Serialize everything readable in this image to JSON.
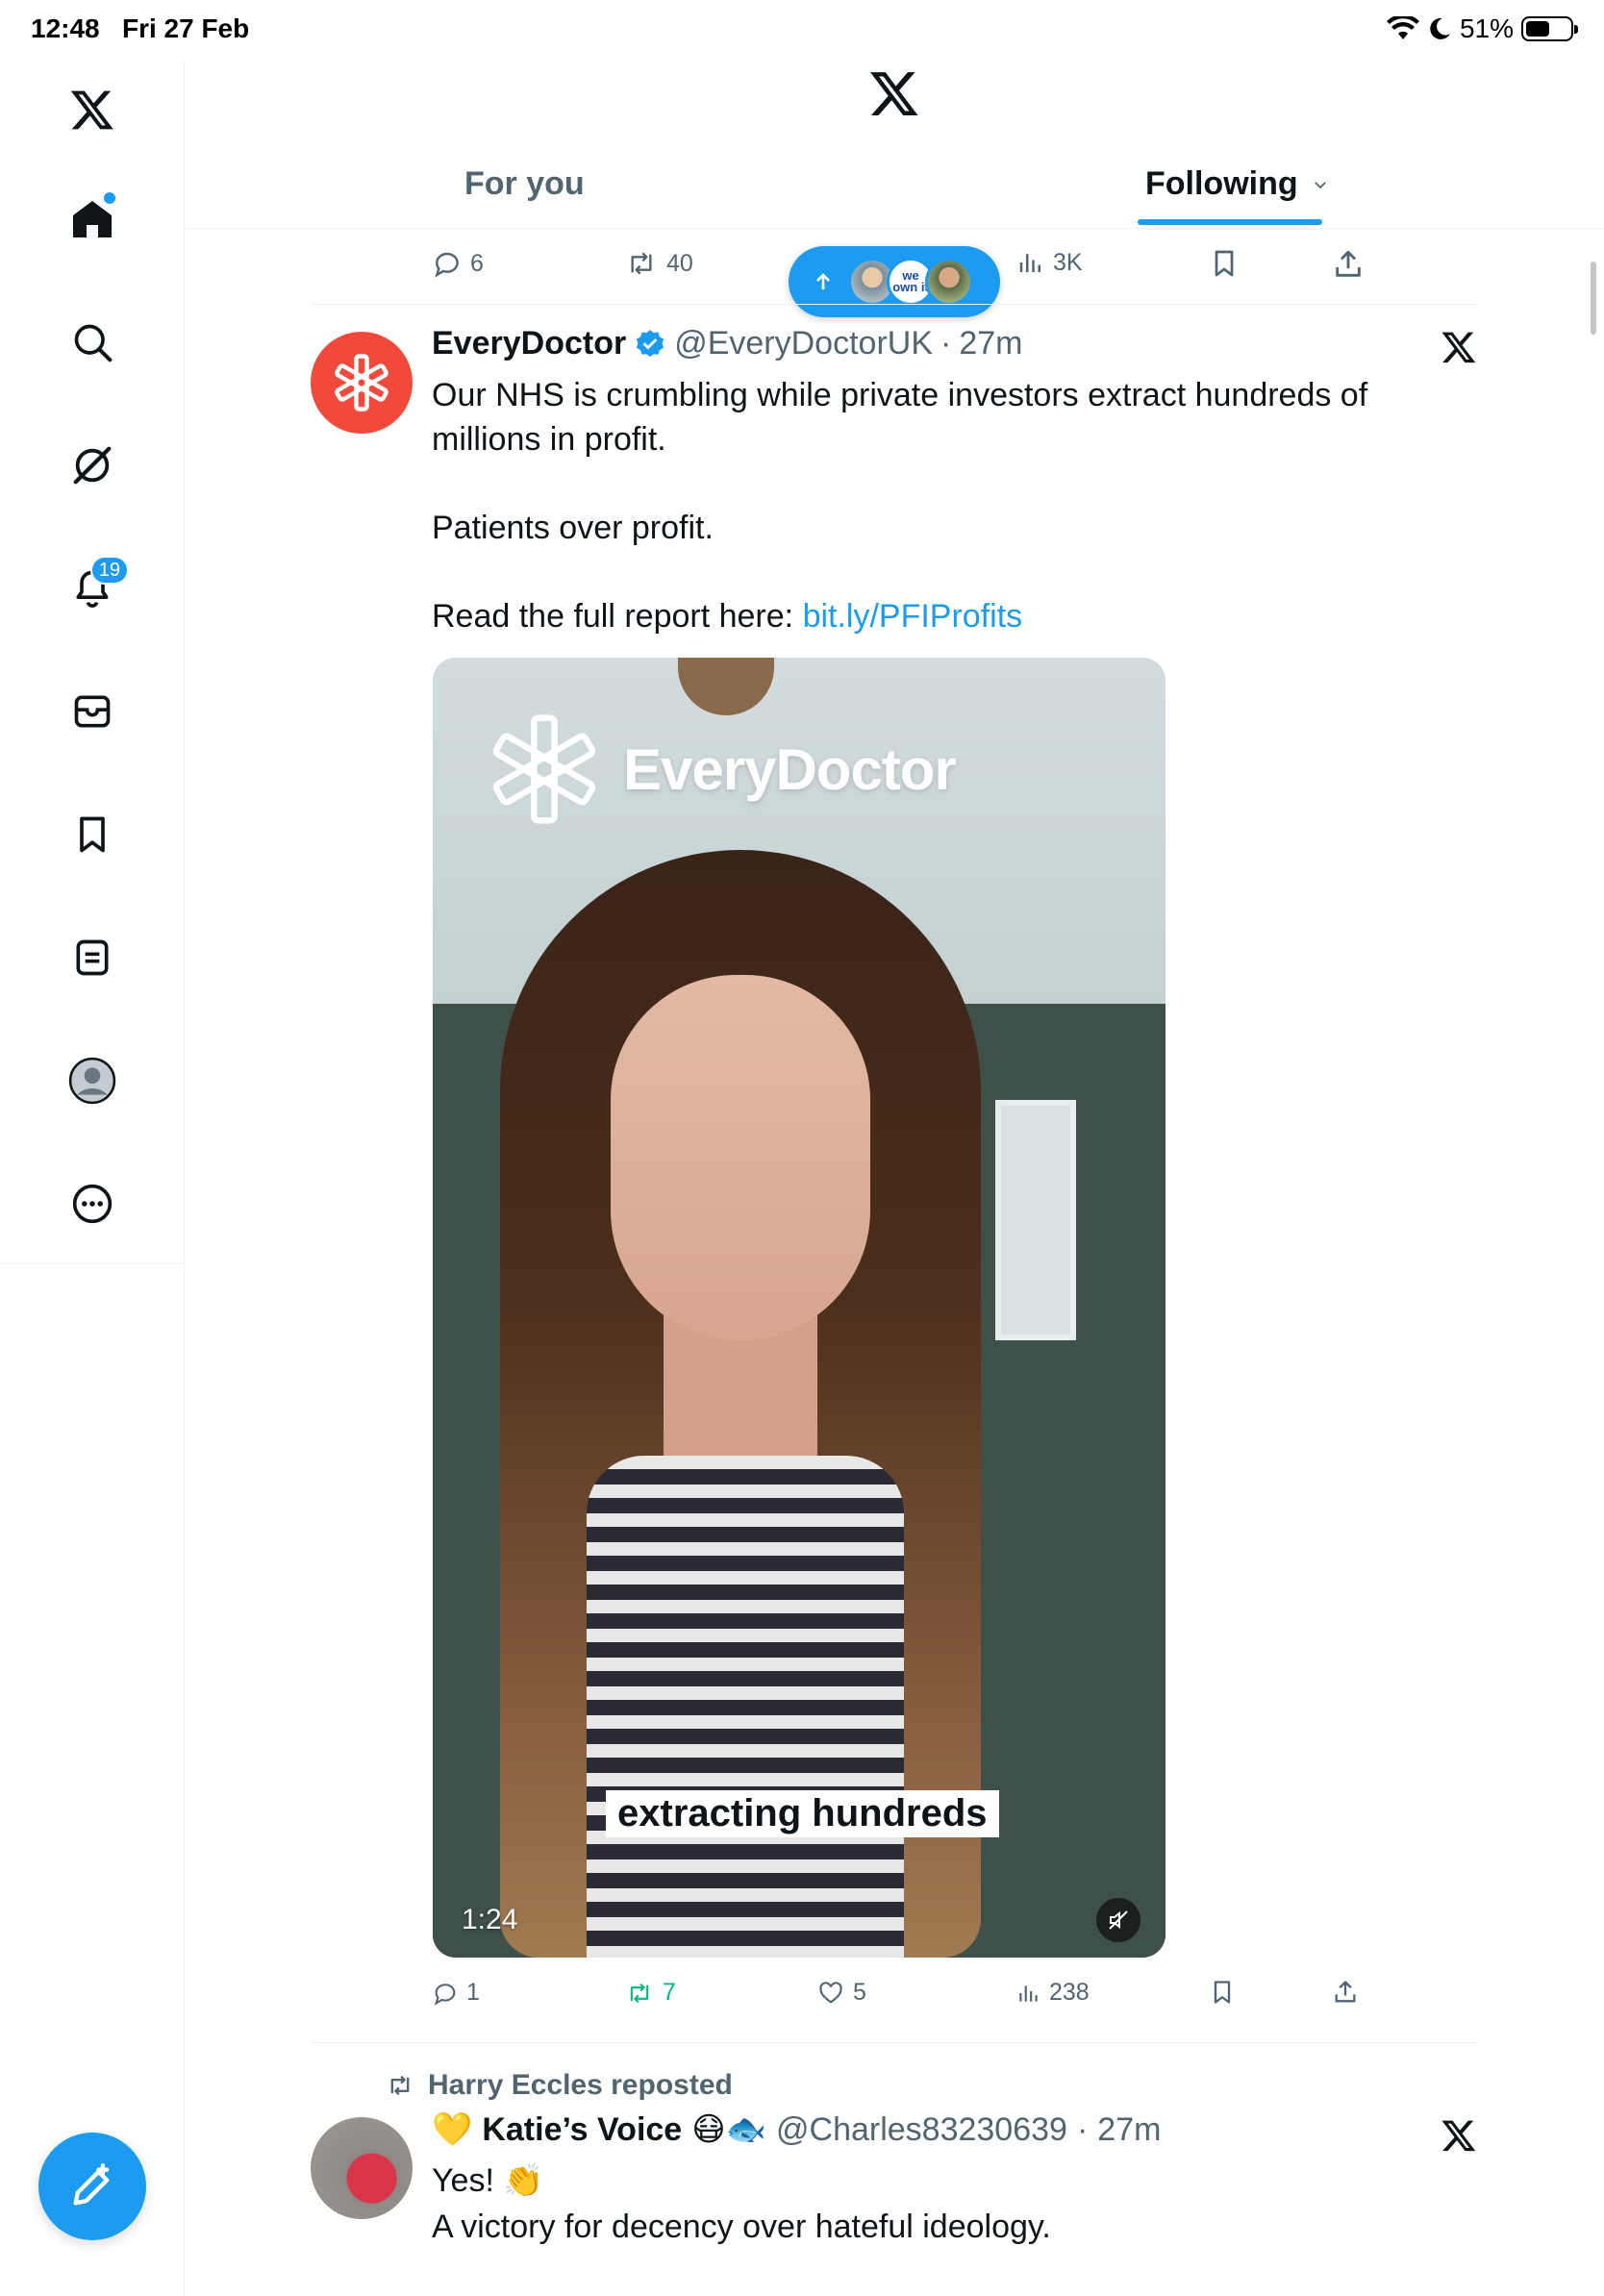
{
  "status_bar": {
    "time": "12:48",
    "date": "Fri 27 Feb",
    "battery": "51%"
  },
  "sidebar": {
    "notifications_count": "19",
    "items": [
      "x-logo",
      "home",
      "search",
      "grok",
      "notifications",
      "messages",
      "bookmarks",
      "lists",
      "profile",
      "more"
    ]
  },
  "tabs": {
    "for_you": "For you",
    "following": "Following"
  },
  "prev_post_actions": {
    "replies": "6",
    "reposts": "40",
    "views": "3K"
  },
  "new_posts_pill": {
    "avatar_text": "we own it"
  },
  "post": {
    "display_name": "EveryDoctor",
    "handle": "@EveryDoctorUK",
    "separator": "·",
    "time": "27m",
    "line1": "Our NHS is crumbling while private investors extract hundreds of millions in profit.",
    "line2": "Patients over profit.",
    "line3_prefix": "Read the full report here: ",
    "link": "bit.ly/PFIProfits",
    "media": {
      "brand_text": "EveryDoctor",
      "caption": "extracting hundreds",
      "duration": "1:24"
    },
    "actions": {
      "replies": "1",
      "reposts": "7",
      "likes": "5",
      "views": "238"
    },
    "colors": {
      "repost_active": "#00ba7c",
      "accent": "#1d9bf0",
      "avatar_bg": "#f14a3d"
    }
  },
  "post2": {
    "reposted_by": "Harry Eccles reposted",
    "heart_emoji": "💛",
    "display_name": "Katie’s Voice",
    "emoji_after": "😷🐟",
    "handle": "@Charles83230639",
    "separator": "·",
    "time": "27m",
    "line1_text": "Yes! ",
    "line1_emoji": "👏",
    "line2": "A victory for decency over hateful ideology."
  }
}
